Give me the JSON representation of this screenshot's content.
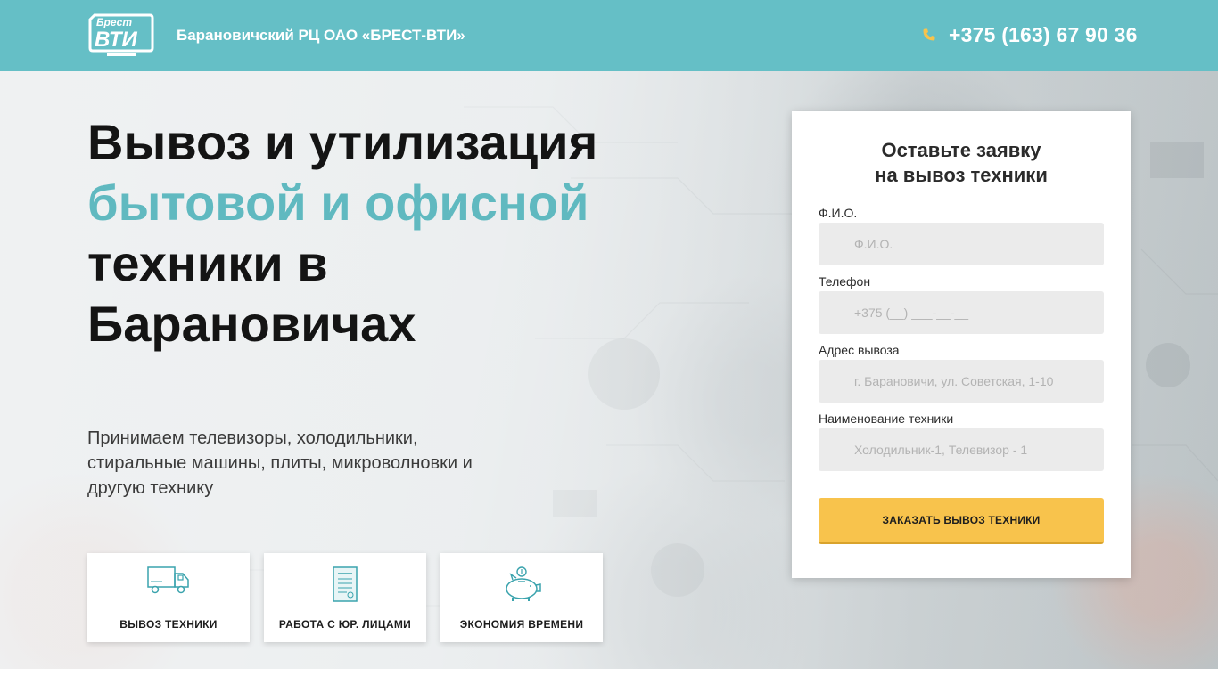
{
  "header": {
    "company": "Барановичский РЦ ОАО «БРЕСТ-ВТИ»",
    "phone": "+375 (163) 67 90 36",
    "logo_top": "Брест",
    "logo_bottom": "ВТИ",
    "bg_color": "#65bfc6"
  },
  "hero": {
    "title_line1": "Вывоз и утилизация",
    "title_accent": "бытовой и офисной",
    "title_line3": "техники в",
    "title_line4": "Барановичах",
    "accent_color": "#60b9c0",
    "subtitle": "Принимаем телевизоры, холодильники, стиральные машины, плиты, микроволновки и другую технику"
  },
  "features": [
    {
      "label": "ВЫВОЗ ТЕХНИКИ",
      "icon": "truck-icon"
    },
    {
      "label": "РАБОТА С ЮР. ЛИЦАМИ",
      "icon": "document-icon"
    },
    {
      "label": "ЭКОНОМИЯ ВРЕМЕНИ",
      "icon": "piggy-bank-icon"
    }
  ],
  "form": {
    "title_line1": "Оставьте заявку",
    "title_line2": "на вывоз техники",
    "fields": [
      {
        "label": "Ф.И.О.",
        "placeholder": "Ф.И.О."
      },
      {
        "label": "Телефон",
        "placeholder": "+375 (__) ___-__-__"
      },
      {
        "label": "Адрес вывоза",
        "placeholder": "г. Барановичи, ул. Советская, 1-10"
      },
      {
        "label": "Наименование техники",
        "placeholder": "Холодильник-1, Телевизор - 1"
      }
    ],
    "submit_label": "ЗАКАЗАТЬ ВЫВОЗ ТЕХНИКИ",
    "button_color": "#f8c34c"
  }
}
